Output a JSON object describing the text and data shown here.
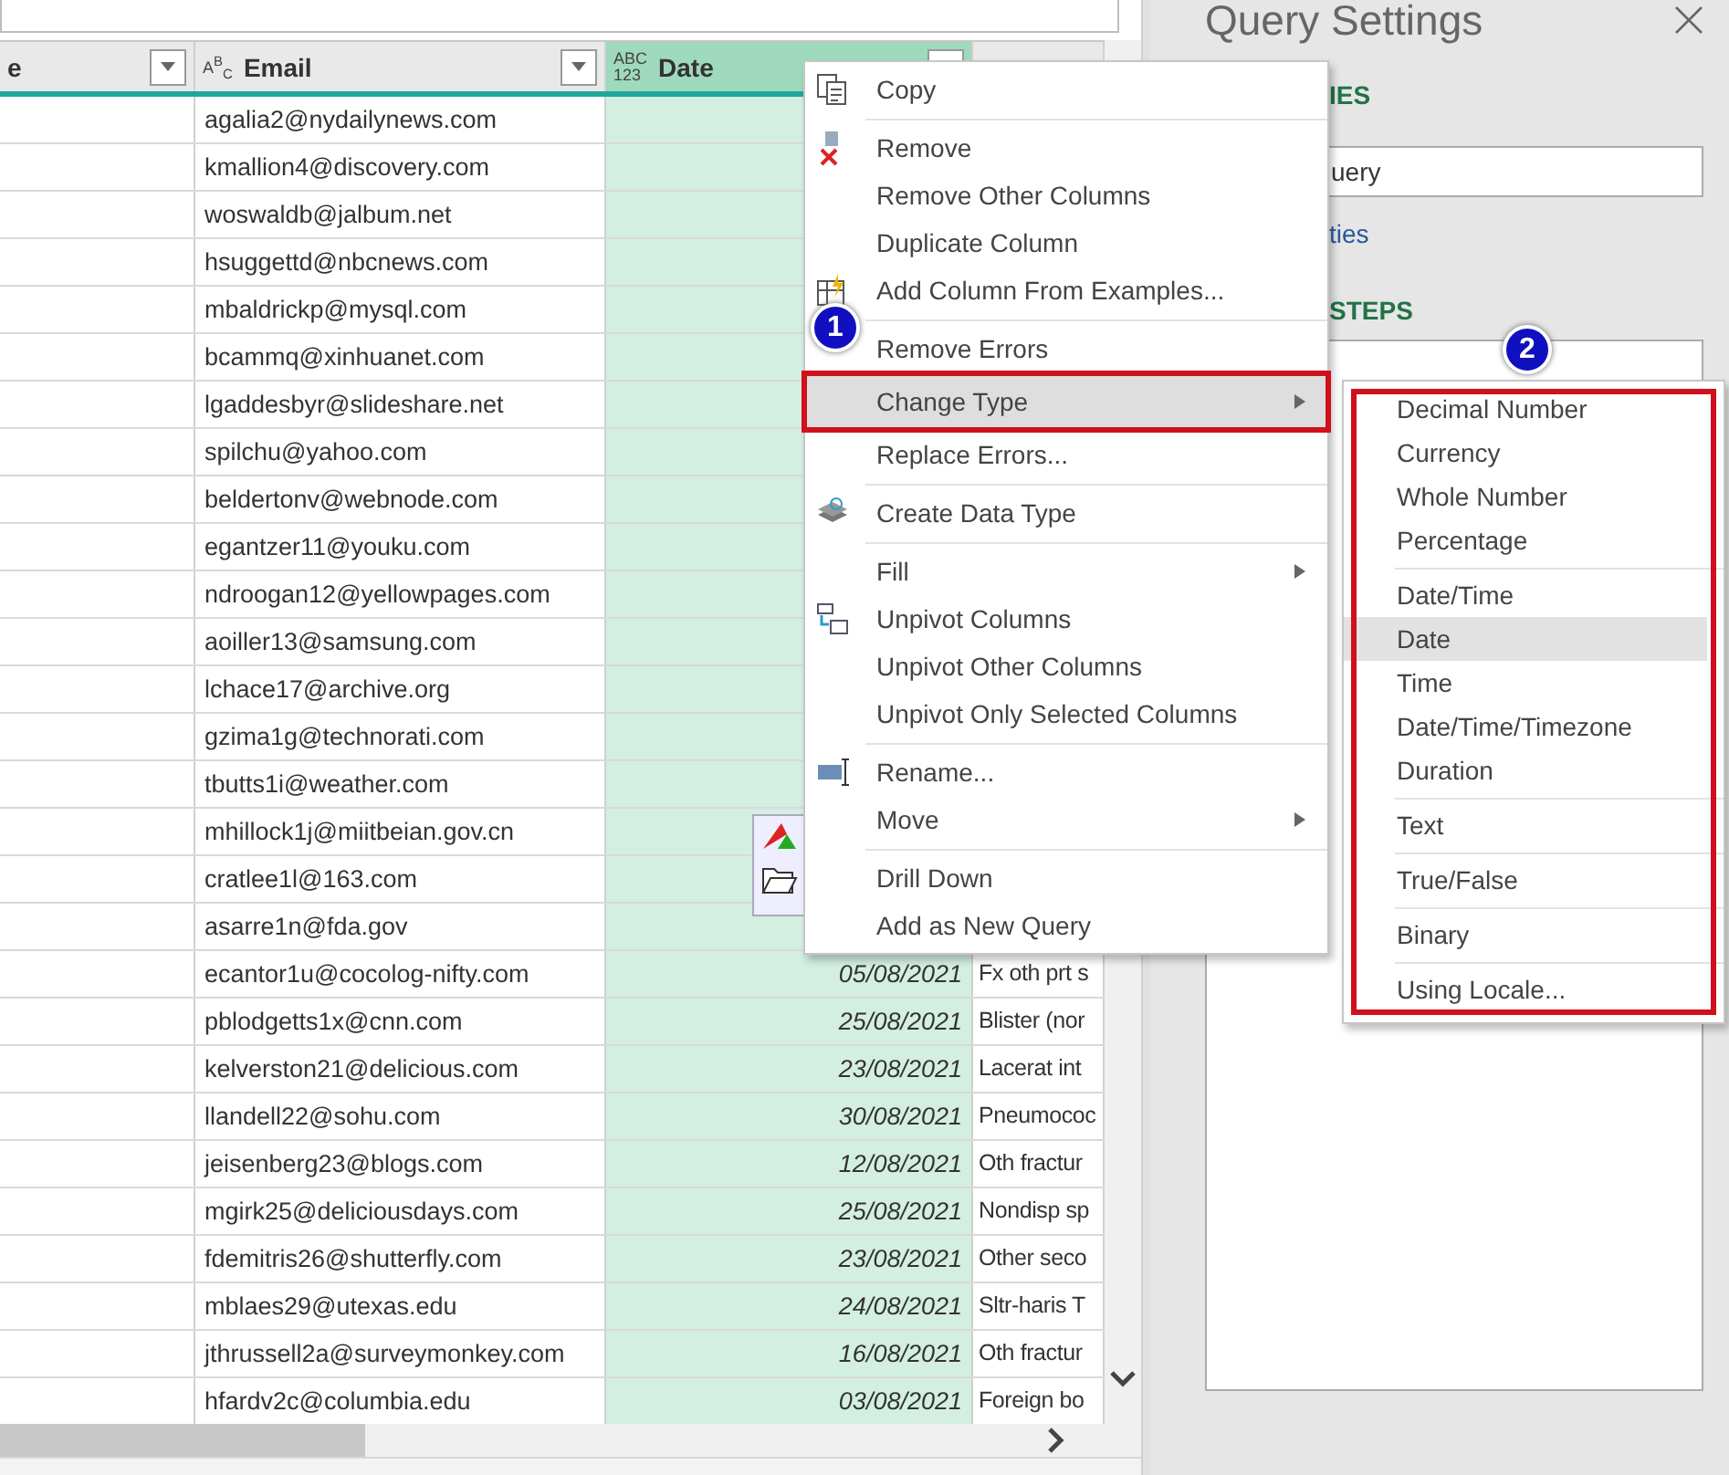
{
  "table": {
    "columns": [
      {
        "label": "e",
        "filter": true,
        "selected": false
      },
      {
        "label": "Email",
        "type_icon": [
          "A$^{B}$$_{C}$"
        ],
        "filter": true,
        "selected": false
      },
      {
        "label": "Date",
        "type_icon": [
          "ABC",
          "123"
        ],
        "filter": true,
        "selected": true
      },
      {
        "selected": false
      }
    ],
    "rows": [
      {
        "email": "agalia2@nydailynews.com"
      },
      {
        "email": "kmallion4@discovery.com"
      },
      {
        "email": "woswaldb@jalbum.net"
      },
      {
        "email": "hsuggettd@nbcnews.com"
      },
      {
        "email": "mbaldrickp@mysql.com"
      },
      {
        "email": "bcammq@xinhuanet.com"
      },
      {
        "email": "lgaddesbyr@slideshare.net"
      },
      {
        "email": "spilchu@yahoo.com"
      },
      {
        "email": "beldertonv@webnode.com"
      },
      {
        "email": "egantzer11@youku.com"
      },
      {
        "email": "ndroogan12@yellowpages.com"
      },
      {
        "email": "aoiller13@samsung.com"
      },
      {
        "email": "lchace17@archive.org"
      },
      {
        "email": "gzima1g@technorati.com"
      },
      {
        "email": "tbutts1i@weather.com"
      },
      {
        "email": "mhillock1j@miitbeian.gov.cn"
      },
      {
        "email": "cratlee1l@163.com"
      },
      {
        "email": "asarre1n@fda.gov"
      },
      {
        "email": "ecantor1u@cocolog-nifty.com",
        "date": "05/08/2021",
        "column_4": "Fx oth prt s"
      },
      {
        "email": "pblodgetts1x@cnn.com",
        "date": "25/08/2021",
        "column_4": "Blister (nor"
      },
      {
        "email": "kelverston21@delicious.com",
        "date": "23/08/2021",
        "column_4": "Lacerat int"
      },
      {
        "email": "llandell22@sohu.com",
        "date": "30/08/2021",
        "column_4": "Pneumococ"
      },
      {
        "email": "jeisenberg23@blogs.com",
        "date": "12/08/2021",
        "column_4": "Oth fractur"
      },
      {
        "email": "mgirk25@deliciousdays.com",
        "date": "25/08/2021",
        "column_4": "Nondisp sp"
      },
      {
        "email": "fdemitris26@shutterfly.com",
        "date": "23/08/2021",
        "column_4": "Other seco"
      },
      {
        "email": "mblaes29@utexas.edu",
        "date": "24/08/2021",
        "column_4": "Sltr-haris T"
      },
      {
        "email": "jthrussell2a@surveymonkey.com",
        "date": "16/08/2021",
        "column_4": "Oth fractur"
      },
      {
        "email": "hfardv2c@columbia.edu",
        "date": "03/08/2021",
        "column_4": "Foreign bo"
      }
    ]
  },
  "query_settings": {
    "title": "Query Settings",
    "properties_heading": "IES",
    "name_value": "uery",
    "properties_link": "ties",
    "steps_heading": "STEPS"
  },
  "context_menu": {
    "items": [
      {
        "kind": "item",
        "label": "Copy",
        "submenu": false,
        "selected": false,
        "callout": false
      },
      {
        "kind": "separator"
      },
      {
        "kind": "item",
        "label": "Remove",
        "submenu": false,
        "selected": false,
        "callout": false
      },
      {
        "kind": "item",
        "label": "Remove Other Columns",
        "submenu": false,
        "selected": false,
        "callout": false
      },
      {
        "kind": "item",
        "label": "Duplicate Column",
        "submenu": false,
        "selected": false,
        "callout": false
      },
      {
        "kind": "item",
        "label": "Add Column From Examples...",
        "submenu": false,
        "selected": false,
        "callout": false
      },
      {
        "kind": "separator"
      },
      {
        "kind": "item",
        "label": "Remove Errors",
        "submenu": false,
        "selected": false,
        "callout": false
      },
      {
        "kind": "item",
        "label": "Change Type",
        "submenu": true,
        "selected": true,
        "callout": true
      },
      {
        "kind": "item",
        "label": "Replace Errors...",
        "submenu": false,
        "selected": false,
        "callout": false
      },
      {
        "kind": "separator"
      },
      {
        "kind": "item",
        "label": "Create Data Type",
        "submenu": false,
        "selected": false,
        "callout": false
      },
      {
        "kind": "separator"
      },
      {
        "kind": "item",
        "label": "Fill",
        "submenu": true,
        "selected": false,
        "callout": false
      },
      {
        "kind": "item",
        "label": "Unpivot Columns",
        "submenu": false,
        "selected": false,
        "callout": false
      },
      {
        "kind": "item",
        "label": "Unpivot Other Columns",
        "submenu": false,
        "selected": false,
        "callout": false
      },
      {
        "kind": "item",
        "label": "Unpivot Only Selected Columns",
        "submenu": false,
        "selected": false,
        "callout": false
      },
      {
        "kind": "separator"
      },
      {
        "kind": "item",
        "label": "Rename...",
        "submenu": false,
        "selected": false,
        "callout": false
      },
      {
        "kind": "item",
        "label": "Move",
        "submenu": true,
        "selected": false,
        "callout": false
      },
      {
        "kind": "separator"
      },
      {
        "kind": "item",
        "label": "Drill Down",
        "submenu": false,
        "selected": false,
        "callout": false
      },
      {
        "kind": "item",
        "label": "Add as New Query",
        "submenu": false,
        "selected": false,
        "callout": false
      }
    ]
  },
  "type_submenu": {
    "callout": true,
    "items": [
      {
        "kind": "item",
        "label": "Decimal Number",
        "selected": false
      },
      {
        "kind": "item",
        "label": "Currency",
        "selected": false
      },
      {
        "kind": "item",
        "label": "Whole Number",
        "selected": false
      },
      {
        "kind": "item",
        "label": "Percentage",
        "selected": false
      },
      {
        "kind": "separator"
      },
      {
        "kind": "item",
        "label": "Date/Time",
        "selected": false
      },
      {
        "kind": "item",
        "label": "Date",
        "selected": true
      },
      {
        "kind": "item",
        "label": "Time",
        "selected": false
      },
      {
        "kind": "item",
        "label": "Date/Time/Timezone",
        "selected": false
      },
      {
        "kind": "item",
        "label": "Duration",
        "selected": false
      },
      {
        "kind": "separator"
      },
      {
        "kind": "item",
        "label": "Text",
        "selected": false
      },
      {
        "kind": "separator"
      },
      {
        "kind": "item",
        "label": "True/False",
        "selected": false
      },
      {
        "kind": "separator"
      },
      {
        "kind": "item",
        "label": "Binary",
        "selected": false
      },
      {
        "kind": "separator"
      },
      {
        "kind": "item",
        "label": "Using Locale...",
        "selected": false
      }
    ]
  },
  "step_badges": [
    {
      "number": "1"
    },
    {
      "number": "2"
    }
  ]
}
